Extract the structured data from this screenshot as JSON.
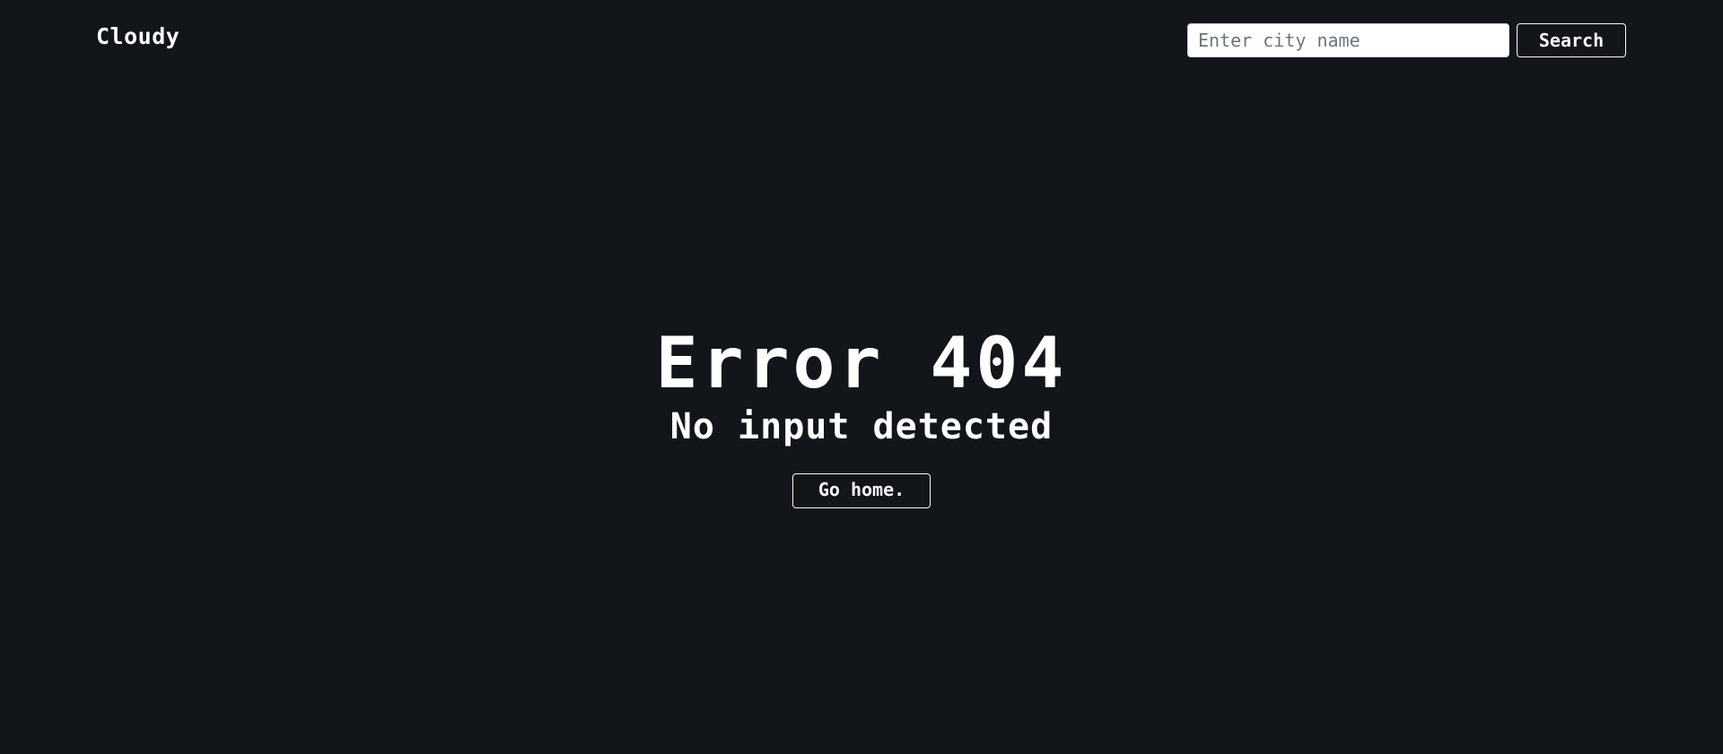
{
  "navbar": {
    "brand": "Cloudy",
    "search": {
      "placeholder": "Enter city name",
      "value": "",
      "button_label": "Search"
    }
  },
  "error": {
    "title": "Error 404",
    "message": "No input detected",
    "home_button_label": "Go home."
  },
  "colors": {
    "background": "#121519",
    "text": "#ffffff",
    "input_background": "#ffffff",
    "button_border": "#f8f9fa"
  }
}
